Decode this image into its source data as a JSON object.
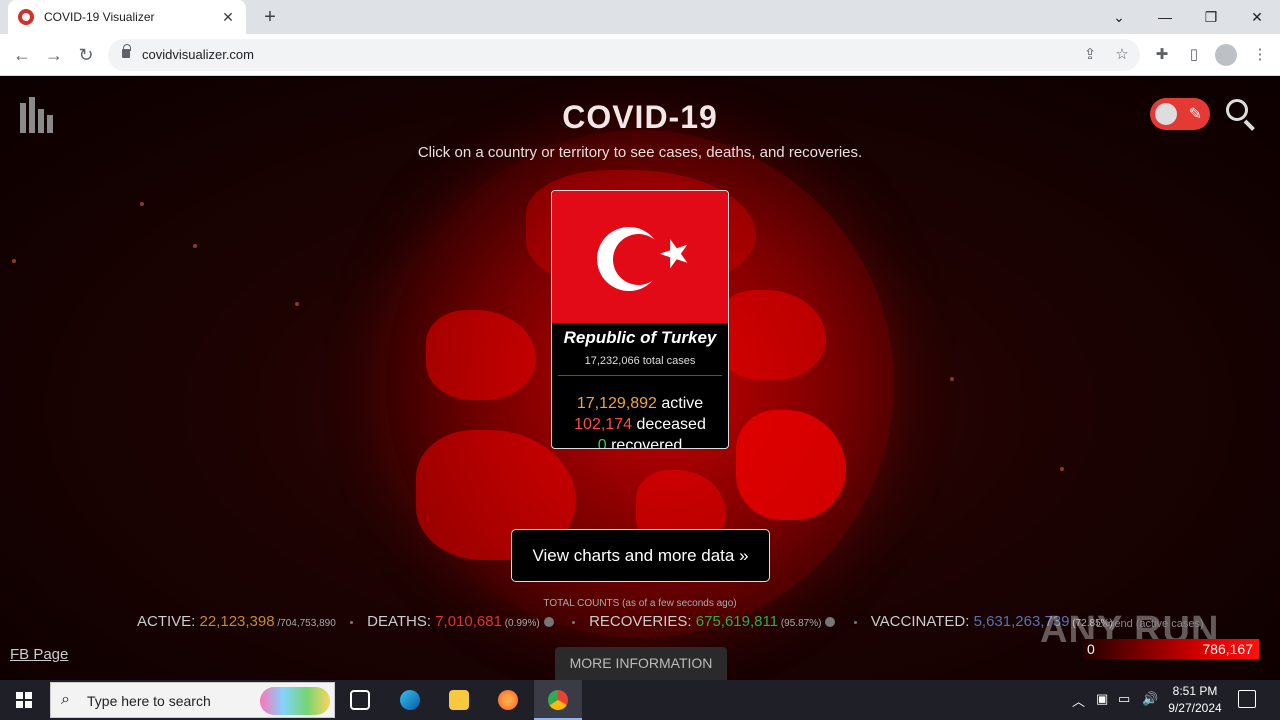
{
  "browser": {
    "tab_title": "COVID-19 Visualizer",
    "url": "covidvisualizer.com"
  },
  "page": {
    "title": "COVID-19",
    "subtitle": "Click on a country or territory to see cases, deaths, and recoveries."
  },
  "card": {
    "country": "Republic of Turkey",
    "total": "17,232,066 total cases",
    "active_num": "17,129,892",
    "active_label": " active",
    "deceased_num": "102,174",
    "deceased_label": " deceased",
    "recovered_num": "0",
    "recovered_label": " recovered"
  },
  "charts_button": "View charts and more data »",
  "totals": {
    "caption": "TOTAL COUNTS (as of a few seconds ago)",
    "active_label": "ACTIVE: ",
    "active_value": "22,123,398",
    "active_of": " /704,753,890",
    "deaths_label": "DEATHS: ",
    "deaths_value": "7,010,681",
    "deaths_pct": " (0.99%)",
    "recoveries_label": "RECOVERIES: ",
    "recoveries_value": "675,619,811",
    "recoveries_pct": " (95.87%)",
    "vaccinated_label": "VACCINATED: ",
    "vaccinated_value": "5,631,263,739",
    "vaccinated_pct": " (72.85%)"
  },
  "legend": {
    "caption": "Legend (active cases)",
    "min": "0",
    "max": "786,167"
  },
  "watermark": "ANY RUN",
  "fb_link": "FB Page",
  "more_info": "MORE INFORMATION",
  "taskbar": {
    "search_placeholder": "Type here to search",
    "time": "8:51 PM",
    "date": "9/27/2024"
  },
  "colors": {
    "active": "#f2a43a",
    "deaths": "#ff4b4b",
    "recovered": "#3ccf4e",
    "vaccinated": "#5b6fb0",
    "toggle": "#e53935"
  }
}
